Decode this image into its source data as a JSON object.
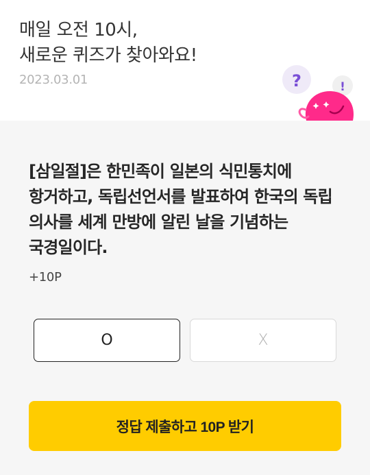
{
  "header": {
    "title": "매일 오전 10시,\n새로운 퀴즈가 찾아와요!",
    "date": "2023.03.01",
    "mascot_icon": "pink-blob-character-icon",
    "mascot_marks": [
      "?",
      "!"
    ]
  },
  "quiz": {
    "question": "[삼일절]은 한민족이 일본의 식민통치에 항거하고, 독립선언서를 발표하여 한국의 독립 의사를 세계 만방에 알린 날을 기념하는 국경일이다.",
    "points": "+10P"
  },
  "answers": {
    "o_label": "O",
    "x_label": "X",
    "selected": "O"
  },
  "submit": {
    "label": "정답 제출하고 10P 받기"
  },
  "colors": {
    "accent": "#ffcc00",
    "mascot_pink": "#ff2a8a",
    "mark_purple": "#7a4fd6",
    "background": "#f6f6f6"
  }
}
